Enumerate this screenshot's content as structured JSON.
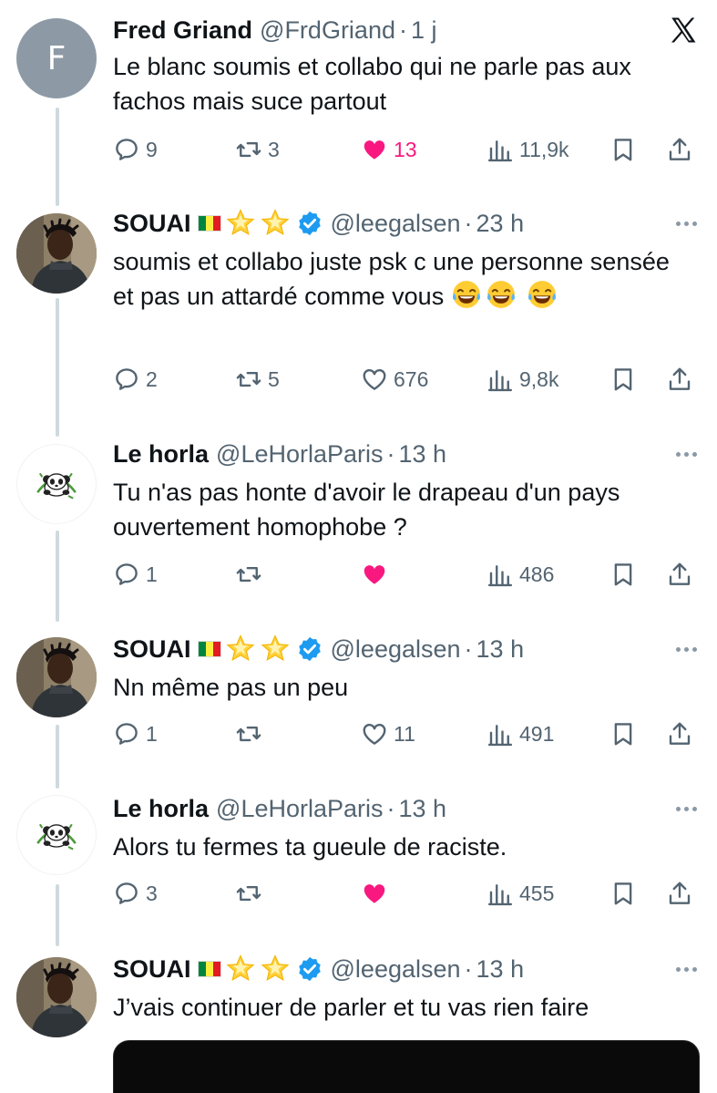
{
  "tweets": [
    {
      "name": "Fred Griand",
      "handle": "@FrdGriand",
      "time": "1 j",
      "avatar_letter": "F",
      "text": "Le blanc soumis et collabo qui ne parle pas aux fachos mais suce partout",
      "replies": "9",
      "retweets": "3",
      "likes": "13",
      "liked": true,
      "views": "11,9k"
    },
    {
      "name": "SOUAI",
      "handle": "@leegalsen",
      "time": "23 h",
      "text": "soumis et collabo juste psk c une personne sensée et pas un attardé comme vous",
      "replies": "2",
      "retweets": "5",
      "likes": "676",
      "liked": false,
      "views": "9,8k"
    },
    {
      "name": "Le horla",
      "handle": "@LeHorlaParis",
      "time": "13 h",
      "text": "Tu n'as pas honte d'avoir le drapeau d'un pays ouvertement homophobe ?",
      "replies": "1",
      "retweets": "",
      "likes": "",
      "liked": true,
      "views": "486"
    },
    {
      "name": "SOUAI",
      "handle": "@leegalsen",
      "time": "13 h",
      "text": "Nn même pas un peu",
      "replies": "1",
      "retweets": "",
      "likes": "11",
      "liked": false,
      "views": "491"
    },
    {
      "name": "Le horla",
      "handle": "@LeHorlaParis",
      "time": "13 h",
      "text": "Alors tu fermes ta gueule de raciste.",
      "replies": "3",
      "retweets": "",
      "likes": "",
      "liked": true,
      "views": "455"
    },
    {
      "name": "SOUAI",
      "handle": "@leegalsen",
      "time": "13 h",
      "text": "J’vais continuer de parler et tu vas rien faire"
    }
  ],
  "separator": "·",
  "colors": {
    "like_active": "#f91880",
    "verified": "#1d9bf0",
    "muted": "#536471",
    "thread_line": "#cfd9de"
  },
  "icons": [
    "x-logo-icon",
    "reply-icon",
    "retweet-icon",
    "heart-icon",
    "views-icon",
    "bookmark-icon",
    "share-icon",
    "more-icon",
    "verified-icon",
    "senegal-flag-icon",
    "star-icon",
    "laughing-emoji-icon",
    "panda-icon"
  ]
}
